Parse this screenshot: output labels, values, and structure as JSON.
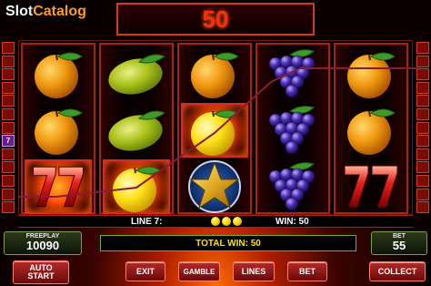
{
  "logo": {
    "text_a": "Slot",
    "text_b": "Catalog"
  },
  "win_display": {
    "value": "50"
  },
  "left_lines": [
    "",
    "",
    "",
    "",
    "",
    "",
    "",
    "7",
    "",
    "",
    "",
    "",
    ""
  ],
  "right_lines": [
    "",
    "",
    "",
    "",
    "",
    "",
    "",
    "",
    "",
    "",
    "",
    "",
    ""
  ],
  "reels": [
    [
      "orange",
      "orange",
      "seven"
    ],
    [
      "lemon",
      "lemon",
      "lemon-yellow"
    ],
    [
      "orange",
      "lemon-yellow",
      "star"
    ],
    [
      "grapes",
      "grapes",
      "grapes"
    ],
    [
      "orange",
      "orange",
      "seven"
    ]
  ],
  "win_cells": [
    "0-2",
    "1-2",
    "2-1"
  ],
  "info_bar": {
    "line_text": "LINE 7:",
    "win_text": "WIN: 50",
    "mini_fruit_count": 3
  },
  "freeplay": {
    "label": "FREEPLAY",
    "value": "10090"
  },
  "total_win": {
    "text": "TOTAL WIN: 50"
  },
  "bet": {
    "label": "BET",
    "value": "55"
  },
  "buttons": {
    "auto_start_line1": "AUTO",
    "auto_start_line2": "START",
    "exit": "EXIT",
    "gamble": "GAMBLE",
    "lines": "LINES",
    "bet": "BET",
    "collect": "COLLECT"
  },
  "colors": {
    "win_red": "#ff2a12",
    "total_win_yellow": "#ffe300",
    "payline": "#8a1a3a"
  }
}
